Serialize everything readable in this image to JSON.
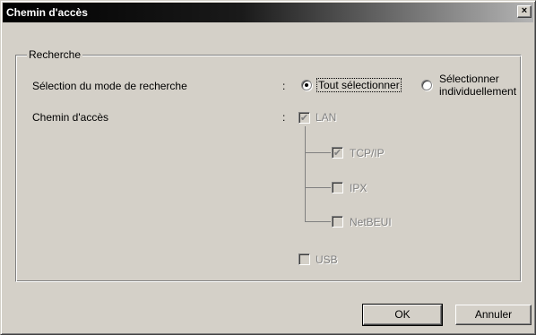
{
  "window": {
    "title": "Chemin d'accès",
    "close_glyph": "×"
  },
  "group": {
    "legend": "Recherche"
  },
  "search_mode": {
    "label": "Sélection du mode de recherche",
    "colon": ":",
    "options": [
      {
        "label": "Tout sélectionner",
        "selected": true
      },
      {
        "label_line1": "Sélectionner",
        "label_line2": "individuellement",
        "selected": false
      }
    ]
  },
  "access_path": {
    "label": "Chemin d'accès",
    "colon": ":",
    "lan": {
      "label": "LAN",
      "checked": true,
      "enabled": false
    },
    "tcpip": {
      "label": "TCP/IP",
      "checked": true,
      "enabled": false
    },
    "ipx": {
      "label": "IPX",
      "checked": false,
      "enabled": false
    },
    "netbeui": {
      "label": "NetBEUI",
      "checked": false,
      "enabled": false
    },
    "usb": {
      "label": "USB",
      "checked": false,
      "enabled": false
    },
    "check_glyph": "✔"
  },
  "buttons": {
    "ok": "OK",
    "cancel": "Annuler"
  }
}
